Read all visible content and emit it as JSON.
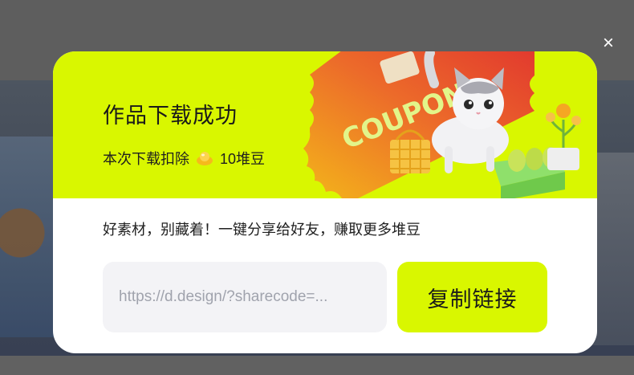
{
  "dialog": {
    "title": "作品下载成功",
    "deduct_prefix": "本次下载扣除",
    "deduct_amount": "10堆豆",
    "share_text": "好素材，别藏着！一键分享给好友，赚取更多堆豆",
    "link_value": "https://d.design/?sharecode=...",
    "copy_label": "复制链接",
    "close_symbol": "×",
    "ticket_text": "COUPON"
  },
  "colors": {
    "accent": "#d9f700",
    "ticket_red": "#e5402c",
    "text": "#1a1a1a",
    "field_bg": "#f3f3f6"
  },
  "icons": [
    "close-icon",
    "bean-icon",
    "coupon-ticket",
    "cat-illustration"
  ]
}
